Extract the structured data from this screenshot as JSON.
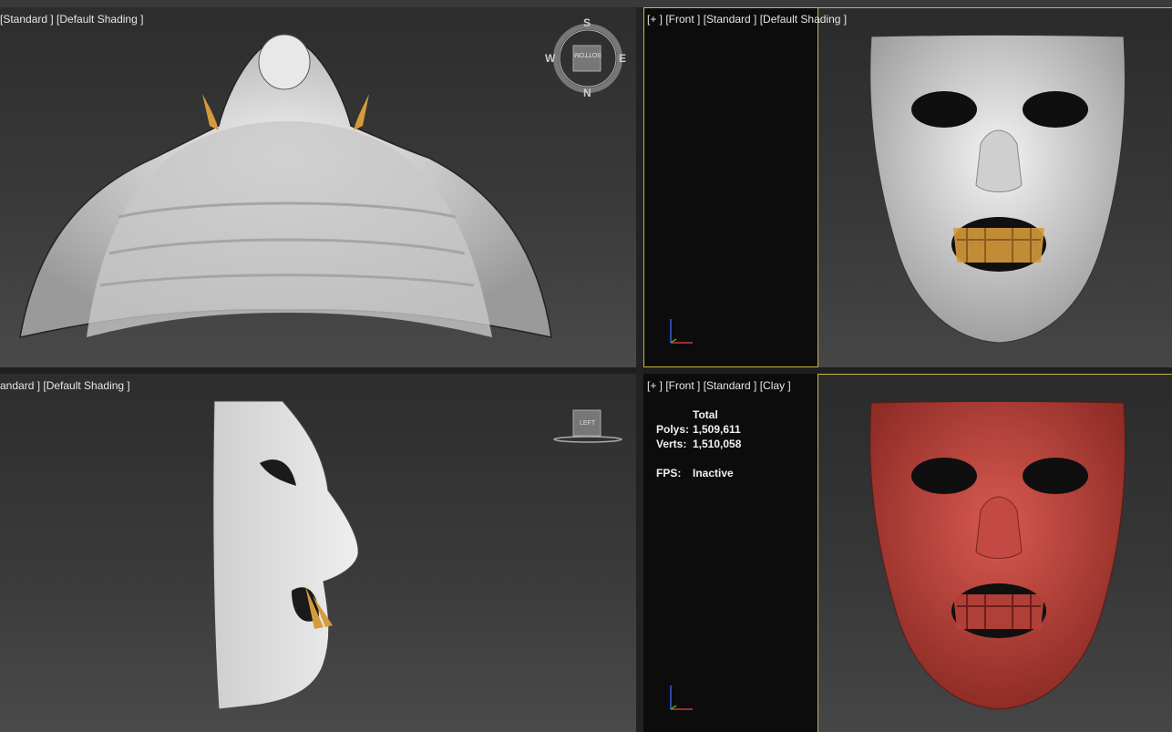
{
  "viewports": {
    "top_left": {
      "label": "[Standard ] [Default Shading ]"
    },
    "top_right": {
      "label": "[+ ] [Front ] [Standard ] [Default Shading ]"
    },
    "bottom_left": {
      "label": "andard ] [Default Shading ]"
    },
    "bottom_right": {
      "label": "[+ ] [Front ] [Standard ] [Clay ]"
    }
  },
  "viewcube": {
    "compass": {
      "north": "N",
      "south": "S",
      "east": "E",
      "west": "W"
    },
    "top_face": "BOTTOM",
    "left_face": "LEFT"
  },
  "stats": {
    "header": "Total",
    "polys_label": "Polys:",
    "polys_value": "1,509,611",
    "verts_label": "Verts:",
    "verts_value": "1,510,058",
    "fps_label": "FPS:",
    "fps_value": "Inactive"
  },
  "colors": {
    "active_border": "#c9b53a",
    "clay": "#b8423a",
    "teeth": "#d69a3c",
    "mesh": "#d8d8d8"
  }
}
